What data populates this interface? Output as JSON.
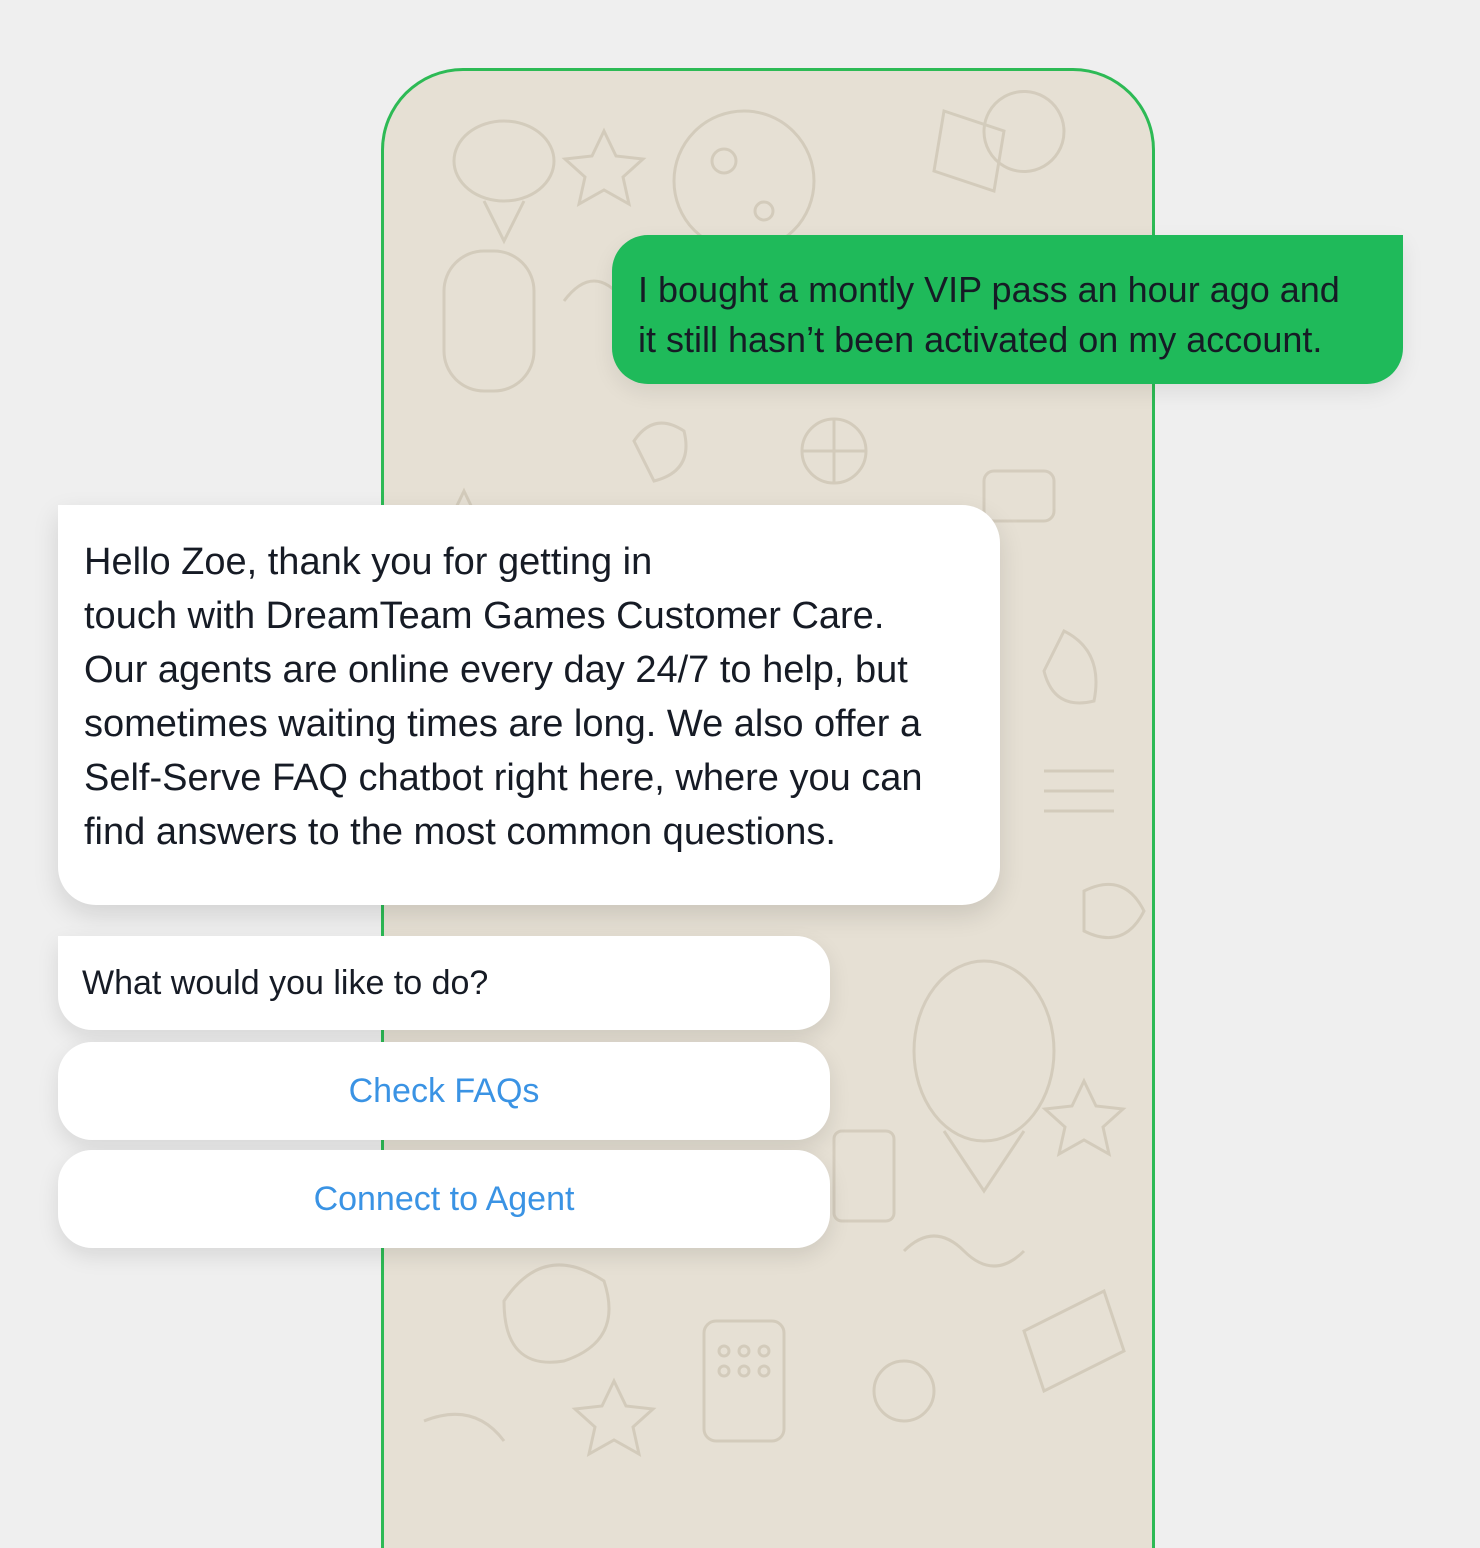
{
  "chat": {
    "outgoing_message": {
      "lines": [
        "I bought a montly VIP pass an hour ago and",
        "it still hasn’t been activated on my account."
      ]
    },
    "incoming_message": {
      "lines": [
        "Hello Zoe, thank you for getting in",
        "touch with DreamTeam Games Customer Care.",
        "Our agents are online every day 24/7 to help, but",
        "sometimes waiting times are long. We also offer a",
        "Self-Serve FAQ chatbot right here, where you can",
        "find answers to the most common questions."
      ]
    },
    "prompt": "What would you like to do?",
    "actions": {
      "check_faqs": "Check FAQs",
      "connect_agent": "Connect to Agent"
    }
  },
  "colors": {
    "frame_border": "#2dba55",
    "outgoing_bubble": "#1fba5a",
    "action_text": "#3a93e4",
    "wallpaper": "#e6e0d4"
  }
}
